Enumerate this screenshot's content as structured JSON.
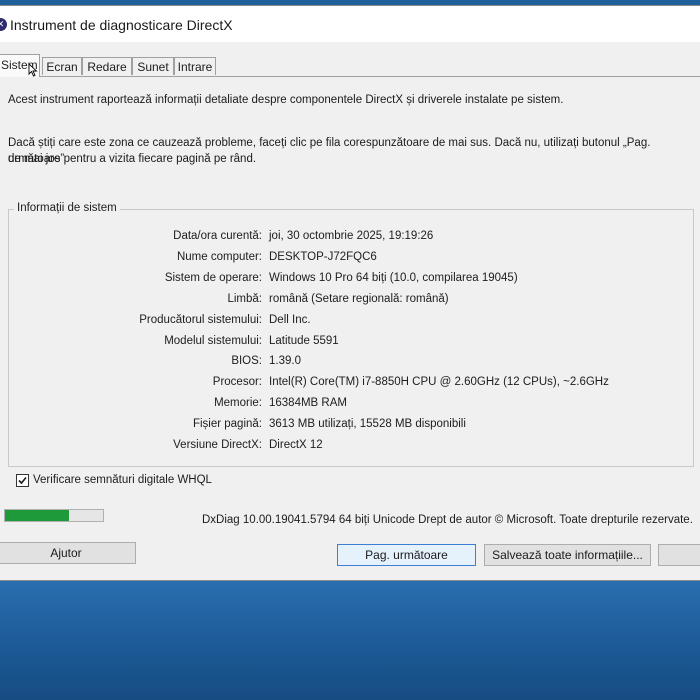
{
  "window": {
    "title": "Instrument de diagnosticare DirectX"
  },
  "tabs": [
    {
      "label": "Sistem",
      "active": true
    },
    {
      "label": "Ecran"
    },
    {
      "label": "Redare"
    },
    {
      "label": "Sunet"
    },
    {
      "label": "Intrare"
    }
  ],
  "intro": {
    "line1": "Acest instrument raportează informații detaliate despre componentele DirectX și driverele instalate pe sistem.",
    "line2a": "Dacă știți care este zona ce cauzează probleme, faceți clic pe fila corespunzătoare de mai sus. Dacă nu, utilizați butonul „Pag. următoare”",
    "line2b": "de mai jos pentru a vizita fiecare pagină pe rând."
  },
  "system_info": {
    "group_label": "Informații de sistem",
    "rows": [
      {
        "label": "Data/ora curentă:",
        "value": "joi, 30 octombrie 2025, 19:19:26"
      },
      {
        "label": "Nume computer:",
        "value": "DESKTOP-J72FQC6"
      },
      {
        "label": "Sistem de operare:",
        "value": "Windows 10 Pro 64 biți (10.0, compilarea 19045)"
      },
      {
        "label": "Limbă:",
        "value": "română (Setare regională: română)"
      },
      {
        "label": "Producătorul sistemului:",
        "value": "Dell Inc."
      },
      {
        "label": "Modelul sistemului:",
        "value": "Latitude 5591"
      },
      {
        "label": "BIOS:",
        "value": "1.39.0"
      },
      {
        "label": "Procesor:",
        "value": "Intel(R) Core(TM) i7-8850H CPU @ 2.60GHz (12 CPUs), ~2.6GHz"
      },
      {
        "label": "Memorie:",
        "value": "16384MB RAM"
      },
      {
        "label": "Fișier pagină:",
        "value": "3613 MB utilizați, 15528 MB disponibili"
      },
      {
        "label": "Versiune DirectX:",
        "value": "DirectX 12"
      }
    ]
  },
  "whql": {
    "label": "Verificare semnături digitale WHQL",
    "checked": true
  },
  "progress": {
    "fraction": 0.65,
    "color": "#1f9a3b"
  },
  "footer": {
    "text": "DxDiag 10.00.19041.5794 64 biți Unicode  Drept de autor © Microsoft. Toate drepturile rezervate."
  },
  "buttons": {
    "help": "Ajutor",
    "next_page": "Pag. următoare",
    "save_all": "Salvează toate informațiile..."
  }
}
